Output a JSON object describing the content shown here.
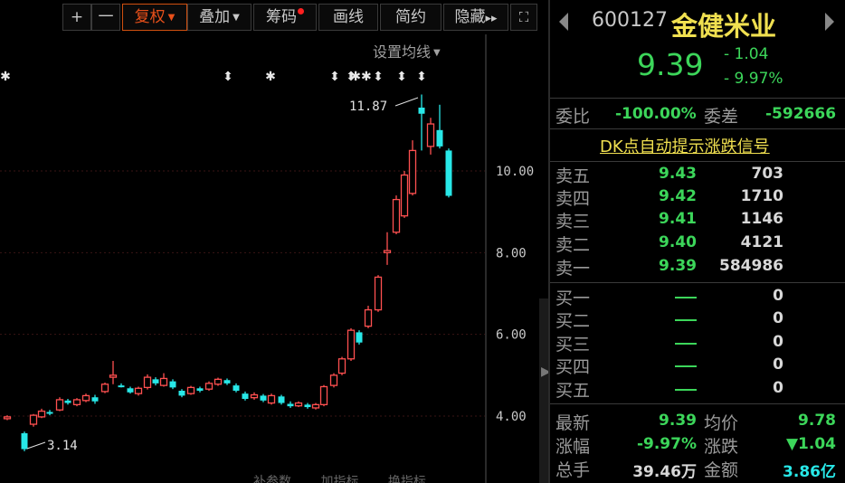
{
  "toolbar": {
    "plus": "+",
    "minus": "一",
    "fuquan": "复权",
    "diejia": "叠加",
    "chouma": "筹码",
    "huaxian": "画线",
    "jianyue": "简约",
    "yincang": "隐藏",
    "yincang_arrow": "▸▸",
    "fullscreen": "⛶"
  },
  "ma_setting": "设置均线",
  "chart": {
    "high_label": "11.87",
    "low_label": "3.14",
    "price_ticks": [
      "10.00",
      "8.00",
      "6.00",
      "4.00"
    ],
    "event_markers": [
      "✱",
      "⬍",
      "✱",
      "⬍",
      "⬍",
      "✱✱",
      "⬍",
      "⬍",
      "⬍"
    ],
    "up_color": "#ff5050",
    "down_color": "#28e8e8"
  },
  "bottom_tabs": [
    "补参数",
    "加指标",
    "换指标"
  ],
  "quote": {
    "code": "600127",
    "name": "金健米业",
    "last": "9.39",
    "change": "- 1.04",
    "change_pct": "- 9.97%",
    "webi_label": "委比",
    "webi": "-100.00%",
    "weicha_label": "委差",
    "weicha": "-592666",
    "dk_link": "DK点自动提示涨跌信号",
    "asks": [
      {
        "label": "卖五",
        "price": "9.43",
        "vol": "703"
      },
      {
        "label": "卖四",
        "price": "9.42",
        "vol": "1710"
      },
      {
        "label": "卖三",
        "price": "9.41",
        "vol": "1146"
      },
      {
        "label": "卖二",
        "price": "9.40",
        "vol": "4121"
      },
      {
        "label": "卖一",
        "price": "9.39",
        "vol": "584986"
      }
    ],
    "bids": [
      {
        "label": "买一",
        "vol": "0"
      },
      {
        "label": "买二",
        "vol": "0"
      },
      {
        "label": "买三",
        "vol": "0"
      },
      {
        "label": "买四",
        "vol": "0"
      },
      {
        "label": "买五",
        "vol": "0"
      }
    ],
    "stats": {
      "latest_label": "最新",
      "latest": "9.39",
      "avg_label": "均价",
      "avg": "9.78",
      "pct_label": "涨幅",
      "pct": "-9.97%",
      "chg_label": "涨跌",
      "chg": "▼1.04",
      "vol_label": "总手",
      "vol": "39.46万",
      "amt_label": "金额",
      "amt": "3.86亿"
    },
    "colors": {
      "down": "#3cd65a",
      "name": "#f0e050",
      "amount": "#28e8e8"
    }
  }
}
